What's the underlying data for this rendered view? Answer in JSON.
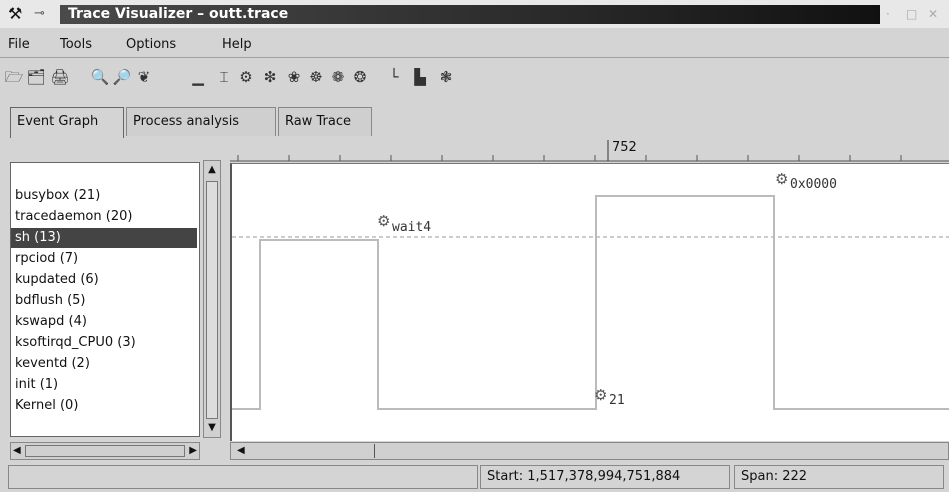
{
  "window": {
    "title": "Trace Visualizer – outt.trace",
    "app_icon": "app-logo-icon",
    "pin_glyph": "⊸",
    "minimize_glyph": "·",
    "maximize_glyph": "□",
    "close_glyph": "✕"
  },
  "menu": {
    "items": [
      "File",
      "Tools",
      "Options",
      "Help"
    ]
  },
  "toolbar": {
    "icons": [
      {
        "name": "open-file-icon",
        "glyph": "🗁"
      },
      {
        "name": "open-folder-icon",
        "glyph": "🗂"
      },
      {
        "name": "print-icon",
        "glyph": "🖨"
      },
      {
        "name": "zoom-in-icon",
        "glyph": "🔍"
      },
      {
        "name": "zoom-out-icon",
        "glyph": "🔎"
      },
      {
        "name": "filter-icon",
        "glyph": "❦"
      },
      {
        "name": "graph-icon",
        "glyph": "▁"
      },
      {
        "name": "cursor-icon",
        "glyph": "⌶"
      },
      {
        "name": "gear-icon",
        "glyph": "⚙"
      },
      {
        "name": "lightning-icon",
        "glyph": "❇"
      },
      {
        "name": "flow-icon",
        "glyph": "❀"
      },
      {
        "name": "search-event-icon",
        "glyph": "☸"
      },
      {
        "name": "goto-event-icon",
        "glyph": "❁"
      },
      {
        "name": "settings-event-icon",
        "glyph": "❂"
      },
      {
        "name": "axis-icon",
        "glyph": "└"
      },
      {
        "name": "histogram-icon",
        "glyph": "▙"
      },
      {
        "name": "stats-icon",
        "glyph": "❃"
      }
    ]
  },
  "tabs": [
    {
      "label": "Event Graph",
      "active": true
    },
    {
      "label": "Process analysis",
      "active": false
    },
    {
      "label": "Raw Trace",
      "active": false
    }
  ],
  "processes": [
    {
      "label": "busybox (21)",
      "selected": false
    },
    {
      "label": "tracedaemon (20)",
      "selected": false
    },
    {
      "label": "sh (13)",
      "selected": true
    },
    {
      "label": "rpciod (7)",
      "selected": false
    },
    {
      "label": "kupdated (6)",
      "selected": false
    },
    {
      "label": "bdflush (5)",
      "selected": false
    },
    {
      "label": "kswapd (4)",
      "selected": false
    },
    {
      "label": "ksoftirqd_CPU0 (3)",
      "selected": false
    },
    {
      "label": "keventd (2)",
      "selected": false
    },
    {
      "label": "init (1)",
      "selected": false
    },
    {
      "label": "Kernel (0)",
      "selected": false
    }
  ],
  "ruler": {
    "label": "752"
  },
  "graph": {
    "events": [
      {
        "name": "wait4-event-label",
        "label": "wait4"
      },
      {
        "name": "event-21-label",
        "label": "21"
      },
      {
        "name": "event-0x0000-label",
        "label": "0x0000"
      }
    ]
  },
  "status": {
    "start": "Start: 1,517,378,994,751,884",
    "span": "Span: 222"
  }
}
